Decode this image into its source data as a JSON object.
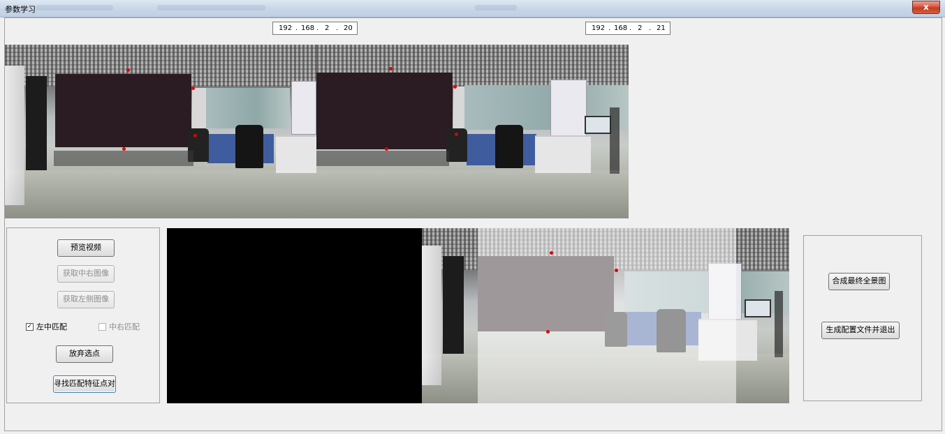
{
  "window": {
    "title": "参数学习",
    "close_glyph": "x"
  },
  "ip_left": {
    "o1": "192",
    "o2": "168",
    "o3": "2",
    "o4": "20"
  },
  "ip_right": {
    "o1": "192",
    "o2": "168",
    "o3": "2",
    "o4": "21"
  },
  "left_panel": {
    "preview_video": "预览视频",
    "get_center_right": "获取中右图像",
    "get_left": "获取左侧图像",
    "left_center_match": {
      "label": "左中匹配",
      "checked": true,
      "mark": "✓"
    },
    "center_right_match": {
      "label": "中右匹配",
      "checked": false
    },
    "discard_points": "放弃选点",
    "find_feature_pairs": "寻找匹配特征点对"
  },
  "right_panel": {
    "compose_panorama": "合成最终全景图",
    "generate_config_exit": "生成配置文件并退出"
  },
  "colors": {
    "marker": "#e00000",
    "titlebar": "#c9d7e8",
    "close": "#c23a20"
  }
}
